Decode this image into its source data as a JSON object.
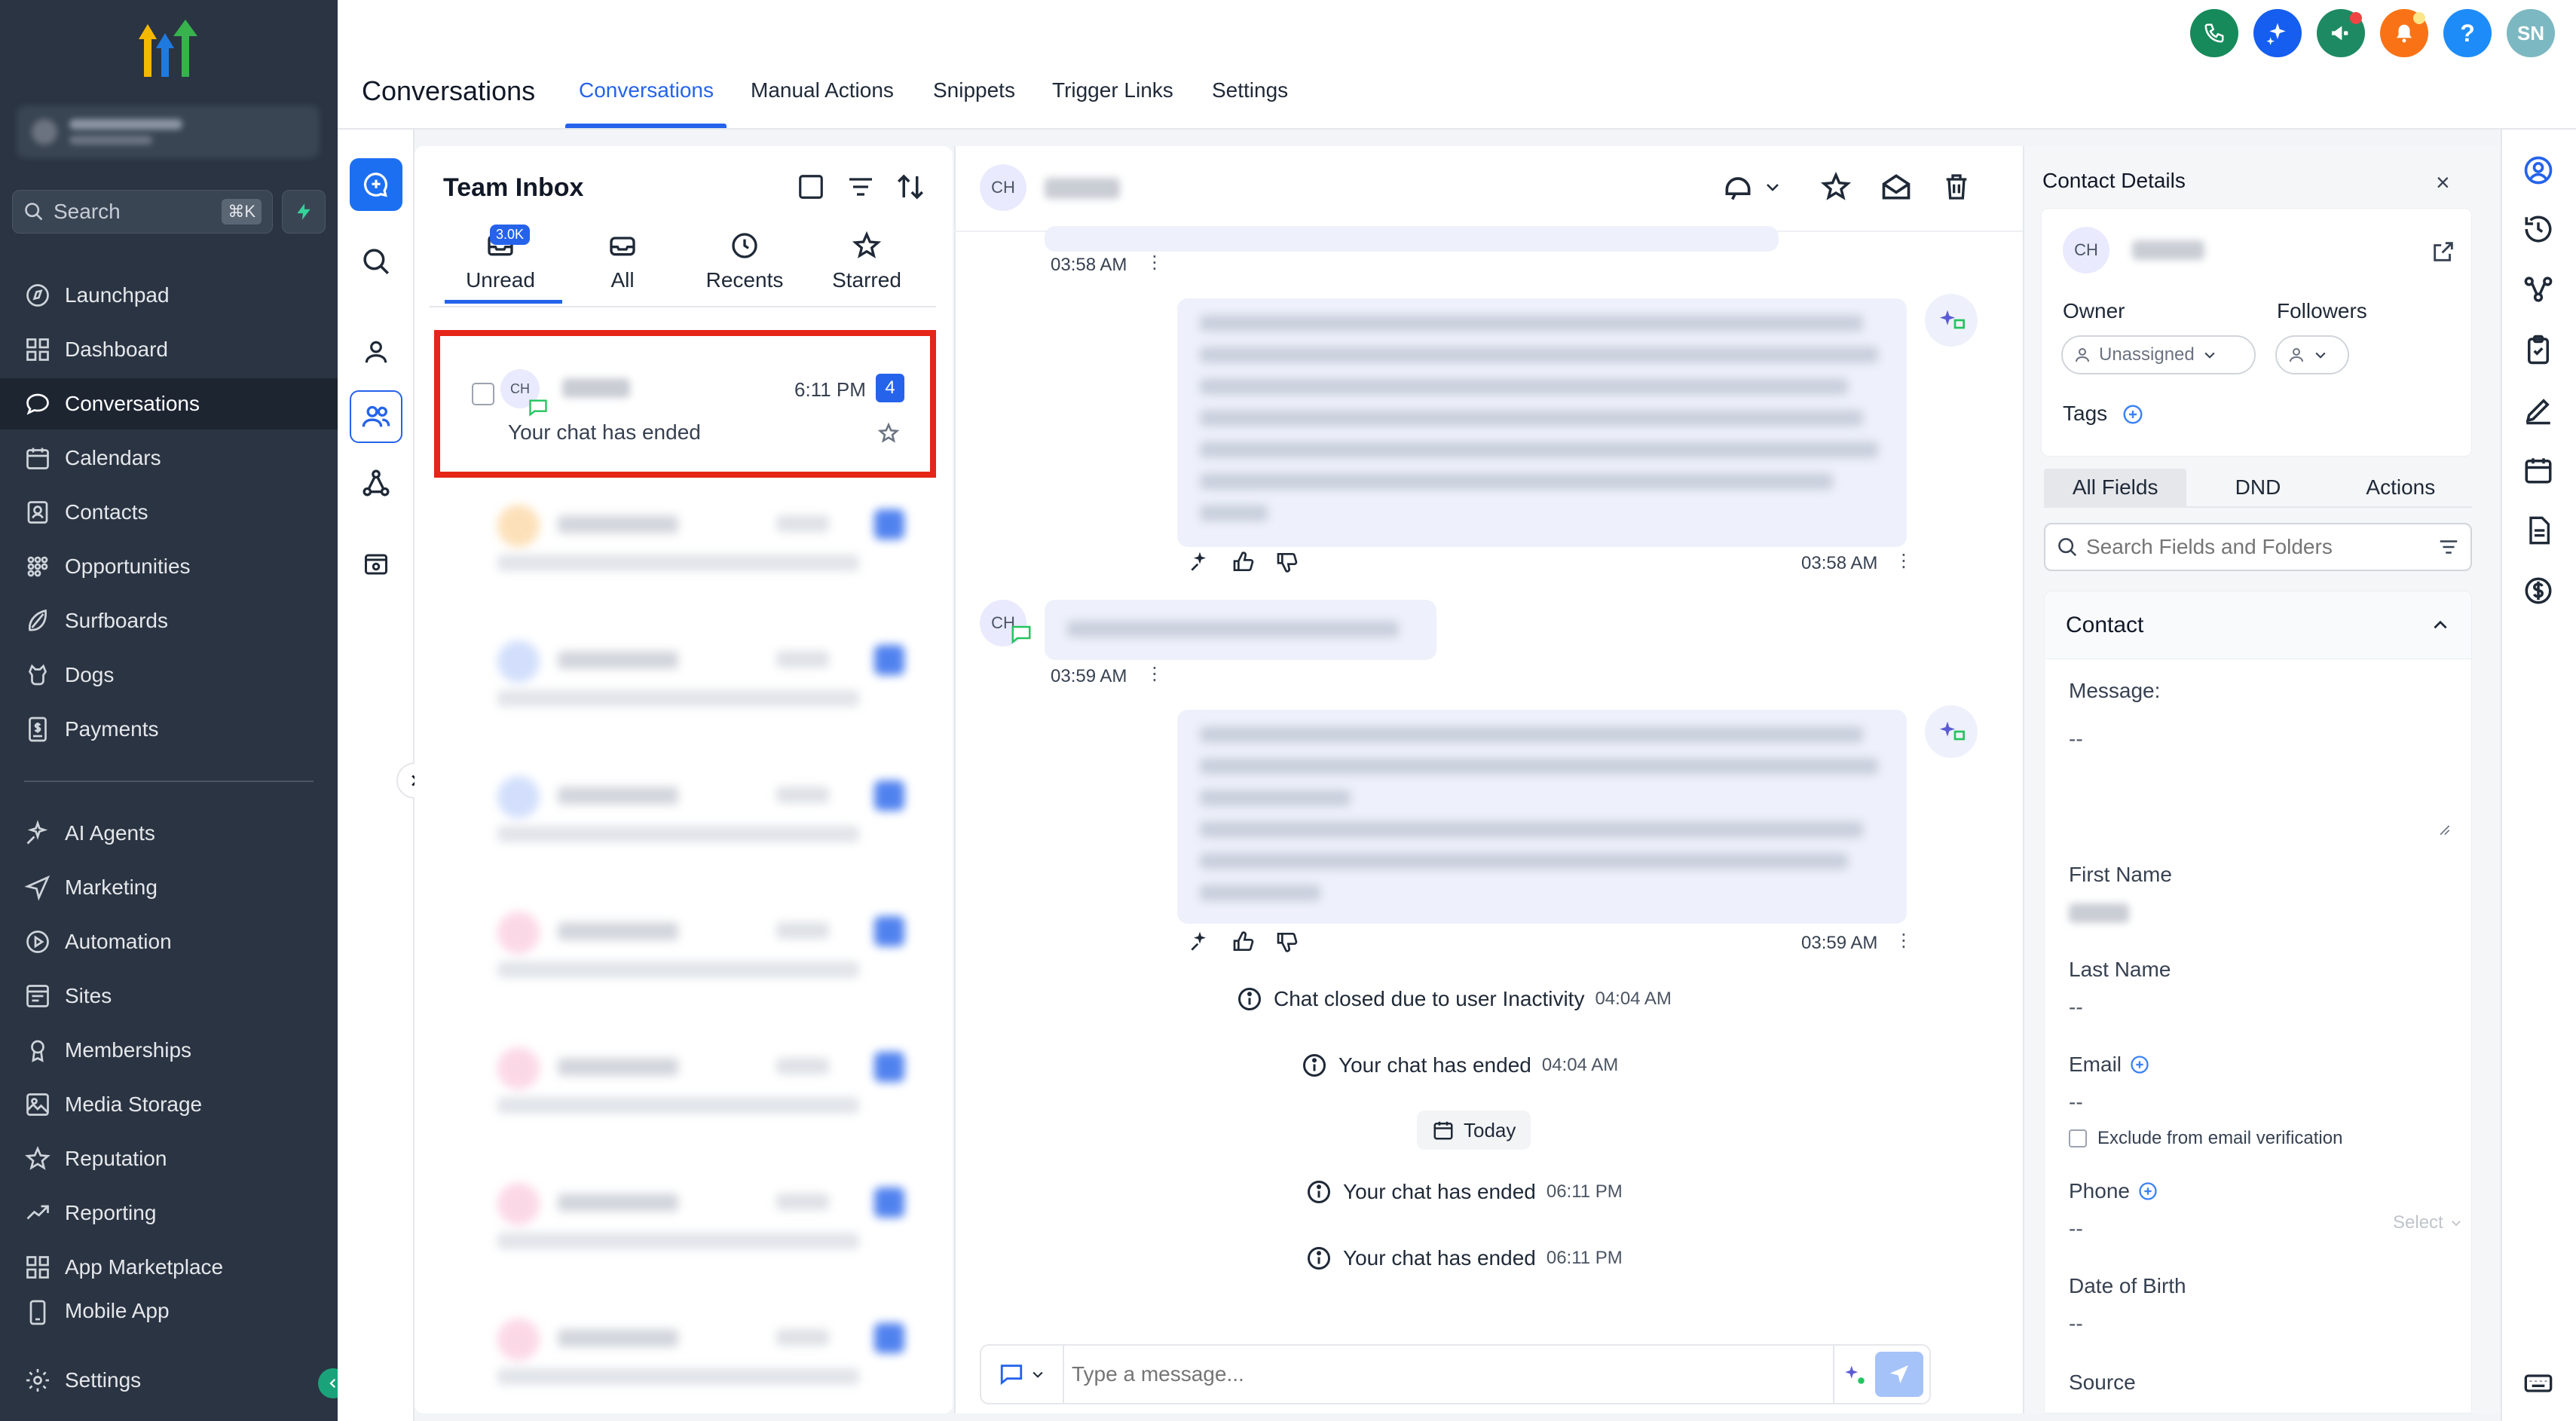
{
  "sidebar": {
    "search_label": "Search",
    "search_shortcut": "⌘K",
    "items": [
      {
        "label": "Launchpad",
        "icon": "launchpad-icon"
      },
      {
        "label": "Dashboard",
        "icon": "dashboard-icon"
      },
      {
        "label": "Conversations",
        "icon": "chat-icon",
        "active": true
      },
      {
        "label": "Calendars",
        "icon": "calendar-icon"
      },
      {
        "label": "Contacts",
        "icon": "contacts-icon"
      },
      {
        "label": "Opportunities",
        "icon": "opportunities-icon"
      },
      {
        "label": "Surfboards",
        "icon": "surfboard-icon"
      },
      {
        "label": "Dogs",
        "icon": "dog-icon"
      },
      {
        "label": "Payments",
        "icon": "payments-icon"
      }
    ],
    "items2": [
      {
        "label": "AI Agents",
        "icon": "ai-agents-icon"
      },
      {
        "label": "Marketing",
        "icon": "marketing-icon"
      },
      {
        "label": "Automation",
        "icon": "automation-icon"
      },
      {
        "label": "Sites",
        "icon": "sites-icon"
      },
      {
        "label": "Memberships",
        "icon": "memberships-icon"
      },
      {
        "label": "Media Storage",
        "icon": "media-icon"
      },
      {
        "label": "Reputation",
        "icon": "star-icon"
      },
      {
        "label": "Reporting",
        "icon": "reporting-icon"
      },
      {
        "label": "App Marketplace",
        "icon": "marketplace-icon"
      },
      {
        "label": "Mobile App",
        "icon": "mobile-icon"
      }
    ],
    "settings_label": "Settings"
  },
  "header": {
    "title": "Conversations",
    "tabs": [
      "Conversations",
      "Manual Actions",
      "Snippets",
      "Trigger Links",
      "Settings"
    ],
    "avatar_initials": "SN",
    "colors": {
      "phone": "#168a5a",
      "ai": "#155eef",
      "megaphone": "#1e8a63",
      "bell": "#f97316",
      "help": "#1d8cf8",
      "avatar": "#7cb8c2"
    }
  },
  "inbox": {
    "title": "Team Inbox",
    "tabs": [
      "Unread",
      "All",
      "Recents",
      "Starred"
    ],
    "unread_badge": "3.0K",
    "selected": {
      "avatar": "CH",
      "time": "6:11 PM",
      "count": "4",
      "preview": "Your chat has ended"
    }
  },
  "chat": {
    "avatar": "CH",
    "messages": [
      {
        "time": "03:58 AM"
      },
      {
        "time": "03:58 AM"
      },
      {
        "time": "03:59 AM"
      },
      {
        "time": "03:59 AM"
      }
    ],
    "events": [
      {
        "text": "Chat closed due to user Inactivity",
        "time": "04:04 AM"
      },
      {
        "text": "Your chat has ended",
        "time": "04:04 AM"
      },
      {
        "text": "Your chat has ended",
        "time": "06:11 PM"
      },
      {
        "text": "Your chat has ended",
        "time": "06:11 PM"
      }
    ],
    "today_label": "Today",
    "composer_placeholder": "Type a message..."
  },
  "details": {
    "title": "Contact Details",
    "avatar": "CH",
    "owner_label": "Owner",
    "owner_value": "Unassigned",
    "followers_label": "Followers",
    "tags_label": "Tags",
    "tabs": [
      "All Fields",
      "DND",
      "Actions"
    ],
    "search_placeholder": "Search Fields and Folders",
    "section_title": "Contact",
    "fields": {
      "message_label": "Message:",
      "message_value": "--",
      "first_name_label": "First Name",
      "last_name_label": "Last Name",
      "last_name_value": "--",
      "email_label": "Email",
      "email_value": "--",
      "exclude_label": "Exclude from email verification",
      "phone_label": "Phone",
      "phone_value": "--",
      "phone_select": "Select",
      "dob_label": "Date of Birth",
      "dob_value": "--",
      "source_label": "Source"
    }
  }
}
